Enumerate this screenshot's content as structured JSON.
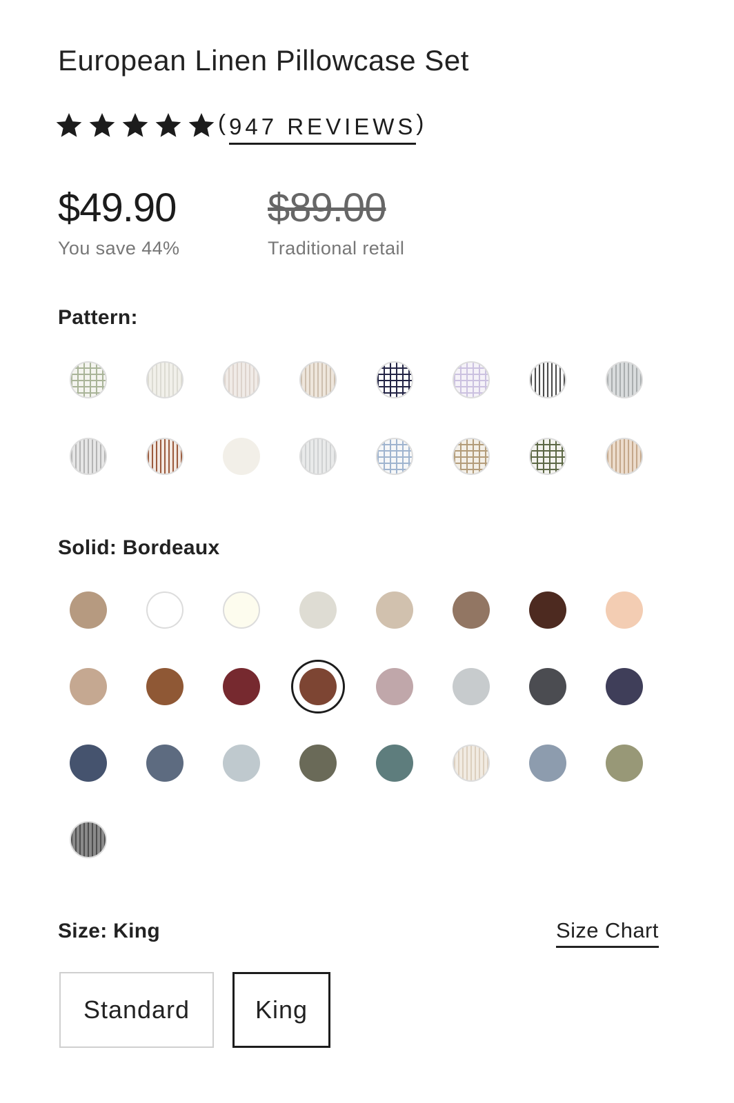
{
  "product": {
    "title": "European Linen Pillowcase Set",
    "rating": 5,
    "reviews_text": "947 REVIEWS",
    "price_now": "$49.90",
    "savings_text": "You save 44%",
    "price_was": "$89.00",
    "retail_text": "Traditional retail"
  },
  "pattern": {
    "label": "Pattern:",
    "swatches": [
      {
        "type": "grid",
        "base": "#f4f4ef",
        "line": "#a9b498"
      },
      {
        "type": "stripe",
        "base": "#f1f0ea",
        "line": "#dcdbd2"
      },
      {
        "type": "stripe",
        "base": "#f0ebe7",
        "line": "#ddd3cc"
      },
      {
        "type": "stripe",
        "base": "#eee6dc",
        "line": "#cdbfae"
      },
      {
        "type": "grid",
        "base": "#ffffff",
        "line": "#232445"
      },
      {
        "type": "grid",
        "base": "#f5f2f8",
        "line": "#cbc1e0"
      },
      {
        "type": "stripe",
        "base": "#f8f8f8",
        "line": "#4a4a4a"
      },
      {
        "type": "stripe",
        "base": "#d9dcdd",
        "line": "#a9adae"
      },
      {
        "type": "stripe",
        "base": "#e6e6e6",
        "line": "#b4b4b4"
      },
      {
        "type": "stripe",
        "base": "#f3e9e2",
        "line": "#9b5a3c"
      },
      {
        "type": "solid",
        "base": "#f2efe8",
        "line": "#f2efe8"
      },
      {
        "type": "stripe",
        "base": "#e9eaea",
        "line": "#cfd1d2"
      },
      {
        "type": "grid",
        "base": "#f6f7f8",
        "line": "#9fb4cf"
      },
      {
        "type": "grid",
        "base": "#f3efe7",
        "line": "#b39c79"
      },
      {
        "type": "grid",
        "base": "#f3f3ee",
        "line": "#5c6845"
      },
      {
        "type": "stripe",
        "base": "#ecdccc",
        "line": "#c4a78a"
      }
    ]
  },
  "solid": {
    "label": "Solid: Bordeaux",
    "selected_index": 11,
    "swatches": [
      {
        "type": "solid",
        "base": "#b69a80"
      },
      {
        "type": "solid",
        "base": "#ffffff"
      },
      {
        "type": "solid",
        "base": "#fdfcee"
      },
      {
        "type": "solid",
        "base": "#dedcd3"
      },
      {
        "type": "solid",
        "base": "#d1c1ae"
      },
      {
        "type": "solid",
        "base": "#927663"
      },
      {
        "type": "solid",
        "base": "#4d2a20"
      },
      {
        "type": "solid",
        "base": "#f3cdb3"
      },
      {
        "type": "solid",
        "base": "#c5a891"
      },
      {
        "type": "solid",
        "base": "#8f5835"
      },
      {
        "type": "solid",
        "base": "#76292f"
      },
      {
        "type": "solid",
        "base": "#7d4533"
      },
      {
        "type": "solid",
        "base": "#c0a7aa"
      },
      {
        "type": "solid",
        "base": "#c7cbcd"
      },
      {
        "type": "solid",
        "base": "#4b4c51"
      },
      {
        "type": "solid",
        "base": "#3f3e59"
      },
      {
        "type": "solid",
        "base": "#45536e"
      },
      {
        "type": "solid",
        "base": "#5d6b80"
      },
      {
        "type": "solid",
        "base": "#bfc9ce"
      },
      {
        "type": "solid",
        "base": "#6a6a58"
      },
      {
        "type": "solid",
        "base": "#5e7d7d"
      },
      {
        "type": "stripe",
        "base": "#f1ebe2",
        "line": "#dccfbe"
      },
      {
        "type": "solid",
        "base": "#8d9cae"
      },
      {
        "type": "solid",
        "base": "#989877"
      },
      {
        "type": "stripe",
        "base": "#8a8a8a",
        "line": "#4e4e4e"
      }
    ]
  },
  "size": {
    "label": "Size: King",
    "chart_link": "Size Chart",
    "options": [
      "Standard",
      "King"
    ],
    "selected": "King"
  }
}
